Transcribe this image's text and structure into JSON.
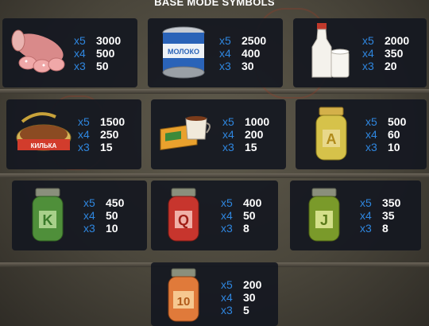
{
  "header": {
    "title": "BASE MODE SYMBOLS"
  },
  "colors": {
    "multiplier": "#2f87e0",
    "value": "#ffffff",
    "panel": "#141820"
  },
  "symbols": [
    {
      "name": "sausage",
      "icon": "sausage-icon",
      "pays": [
        [
          "x5",
          "3000"
        ],
        [
          "x4",
          "500"
        ],
        [
          "x3",
          "50"
        ]
      ]
    },
    {
      "name": "milk can",
      "icon": "condensed-milk-icon",
      "can_label": "МОЛОКО",
      "pays": [
        [
          "x5",
          "2500"
        ],
        [
          "x4",
          "400"
        ],
        [
          "x3",
          "30"
        ]
      ]
    },
    {
      "name": "milk",
      "icon": "milk-bottle-icon",
      "pays": [
        [
          "x5",
          "2000"
        ],
        [
          "x4",
          "350"
        ],
        [
          "x3",
          "20"
        ]
      ]
    },
    {
      "name": "sprats",
      "icon": "sprats-can-icon",
      "can_label": "КИЛЬКА",
      "pays": [
        [
          "x5",
          "1500"
        ],
        [
          "x4",
          "250"
        ],
        [
          "x3",
          "15"
        ]
      ]
    },
    {
      "name": "tea",
      "icon": "tea-cup-icon",
      "pays": [
        [
          "x5",
          "1000"
        ],
        [
          "x4",
          "200"
        ],
        [
          "x3",
          "15"
        ]
      ]
    },
    {
      "name": "A",
      "icon": "jar-a-icon",
      "letter": "A",
      "pays": [
        [
          "x5",
          "500"
        ],
        [
          "x4",
          "60"
        ],
        [
          "x3",
          "10"
        ]
      ]
    },
    {
      "name": "K",
      "icon": "jar-k-icon",
      "letter": "K",
      "pays": [
        [
          "x5",
          "450"
        ],
        [
          "x4",
          "50"
        ],
        [
          "x3",
          "10"
        ]
      ]
    },
    {
      "name": "Q",
      "icon": "jar-q-icon",
      "letter": "Q",
      "pays": [
        [
          "x5",
          "400"
        ],
        [
          "x4",
          "50"
        ],
        [
          "x3",
          "8"
        ]
      ]
    },
    {
      "name": "J",
      "icon": "jar-j-icon",
      "letter": "J",
      "pays": [
        [
          "x5",
          "350"
        ],
        [
          "x4",
          "35"
        ],
        [
          "x3",
          "8"
        ]
      ]
    },
    {
      "name": "10",
      "icon": "jar-10-icon",
      "letter": "10",
      "pays": [
        [
          "x5",
          "200"
        ],
        [
          "x4",
          "30"
        ],
        [
          "x3",
          "5"
        ]
      ]
    }
  ]
}
